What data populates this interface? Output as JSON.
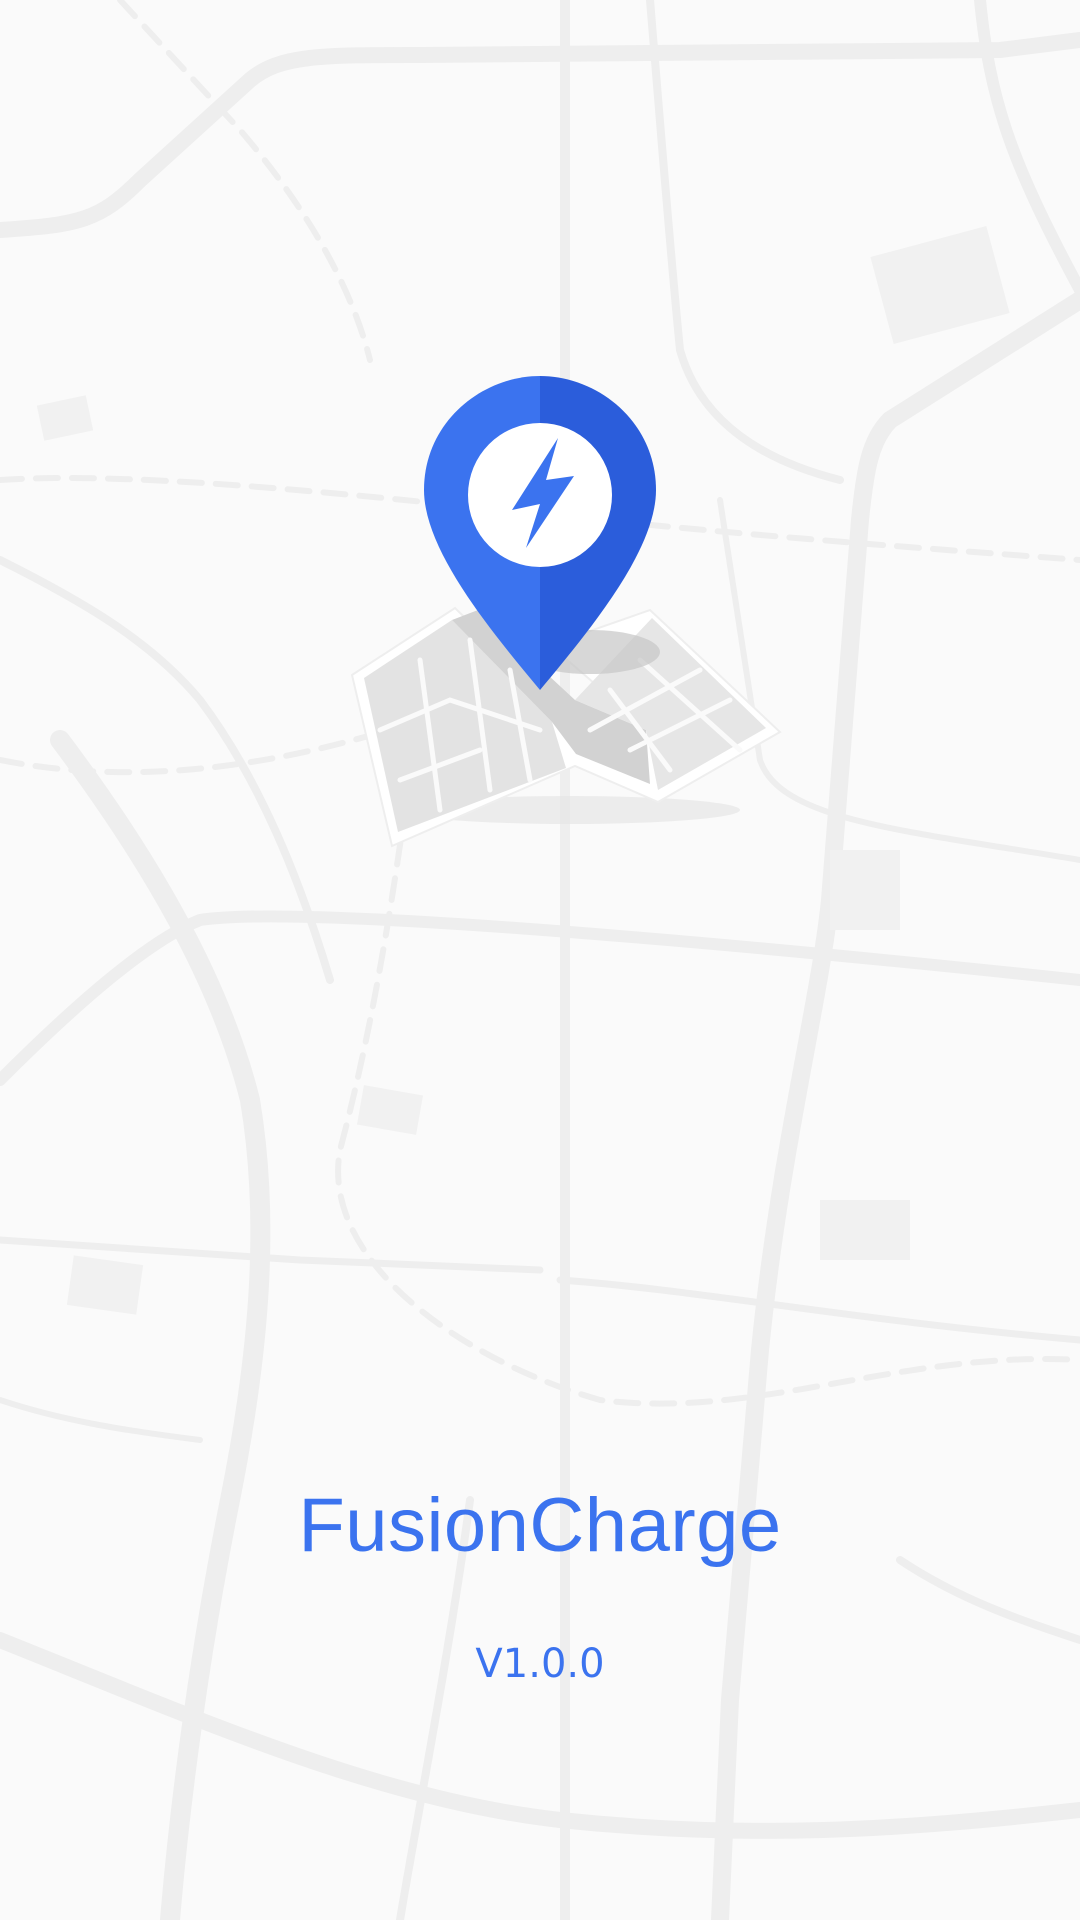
{
  "splash": {
    "app_name": "FusionCharge",
    "version": "V1.0.0"
  },
  "logo": {
    "icon": "map-pin-lightning-icon",
    "pin_color": "#3b73ef",
    "pin_shade_color": "#2b5ddb",
    "bolt_color": "#3b73ef",
    "map_icon": "folded-map-icon"
  },
  "background": {
    "image": "street-map-background",
    "color": "#fafafa",
    "road_color": "#ececec"
  }
}
